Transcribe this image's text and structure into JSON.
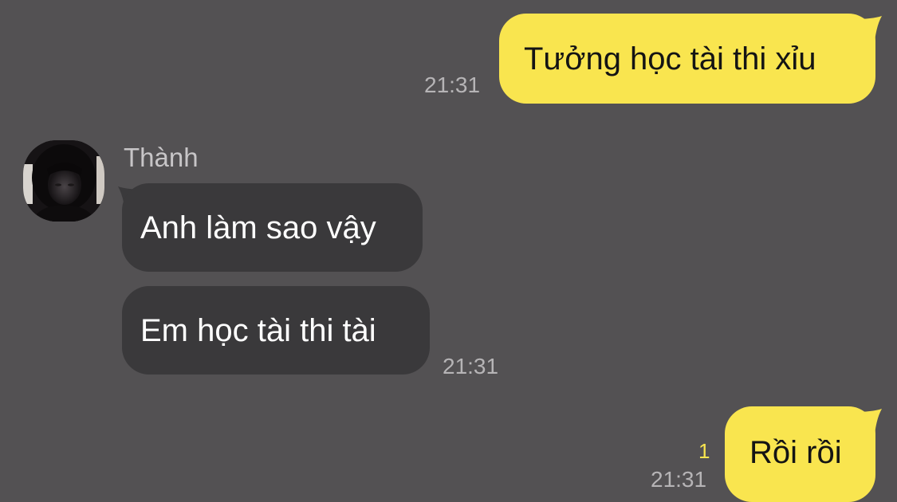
{
  "chat": {
    "messages": [
      {
        "direction": "outgoing",
        "text": "Tưởng học tài thi xỉu",
        "time": "21:31"
      },
      {
        "direction": "incoming",
        "sender": "Thành",
        "text": "Anh làm sao vậy"
      },
      {
        "direction": "incoming",
        "sender": "Thành",
        "text": "Em học tài thi tài",
        "time": "21:31"
      },
      {
        "direction": "outgoing",
        "text": "Rồi rồi",
        "time": "21:31",
        "unread_count": "1"
      }
    ]
  },
  "colors": {
    "background": "#535153",
    "outgoing_bubble": "#f9e54f",
    "incoming_bubble": "#3a393b",
    "timestamp": "#b6b4b6",
    "unread_count": "#f9e54f"
  },
  "icons": {
    "avatar": "user-avatar-photo"
  }
}
